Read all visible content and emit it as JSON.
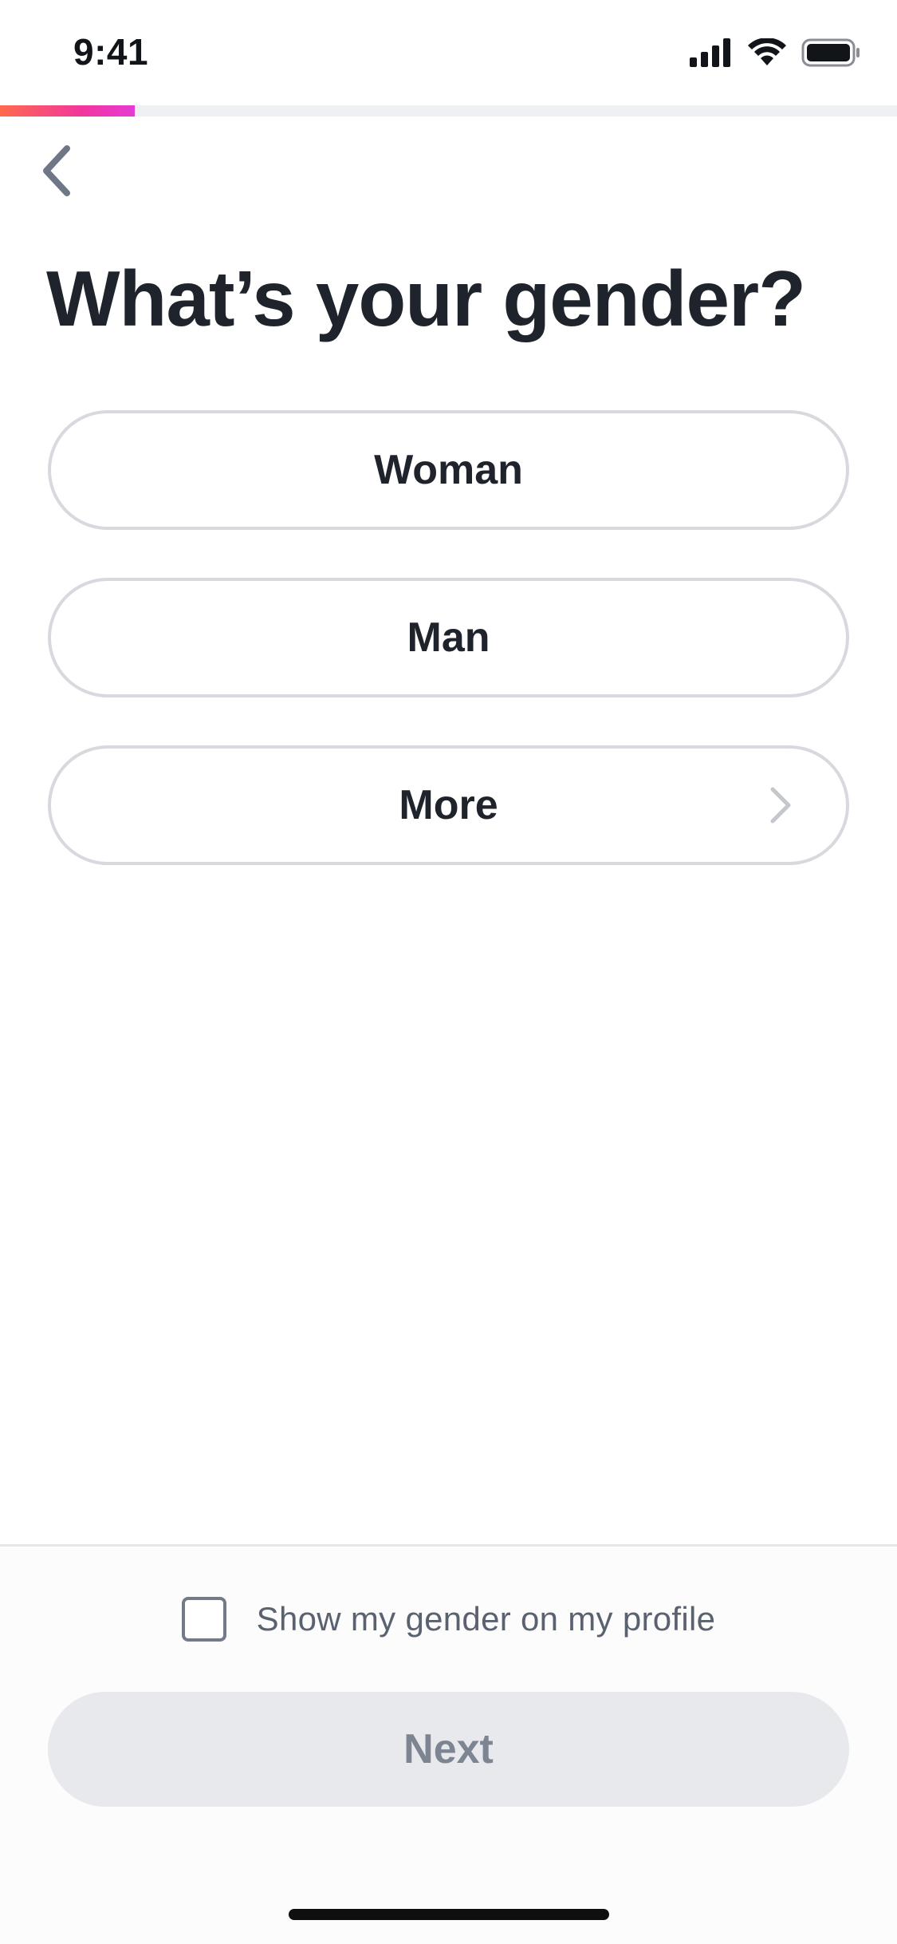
{
  "status_bar": {
    "time": "9:41",
    "icons": [
      "cellular-signal-icon",
      "wifi-icon",
      "battery-icon"
    ]
  },
  "progress": {
    "fraction": 0.15,
    "gradient_colors": [
      "#fd6b4d",
      "#f3369c",
      "#e43bd4"
    ]
  },
  "navigation": {
    "back_icon": "chevron-left-icon"
  },
  "page": {
    "title": "What’s your gender?"
  },
  "options": [
    {
      "label": "Woman",
      "has_chevron": false
    },
    {
      "label": "Man",
      "has_chevron": false
    },
    {
      "label": "More",
      "has_chevron": true
    }
  ],
  "footer": {
    "checkbox_label": "Show my gender on my profile",
    "checkbox_checked": false,
    "next_label": "Next",
    "next_enabled": false
  },
  "colors": {
    "text_primary": "#1f232b",
    "border": "#d7d9de",
    "disabled_bg": "#e8e9ec",
    "disabled_text": "#7d8592"
  }
}
